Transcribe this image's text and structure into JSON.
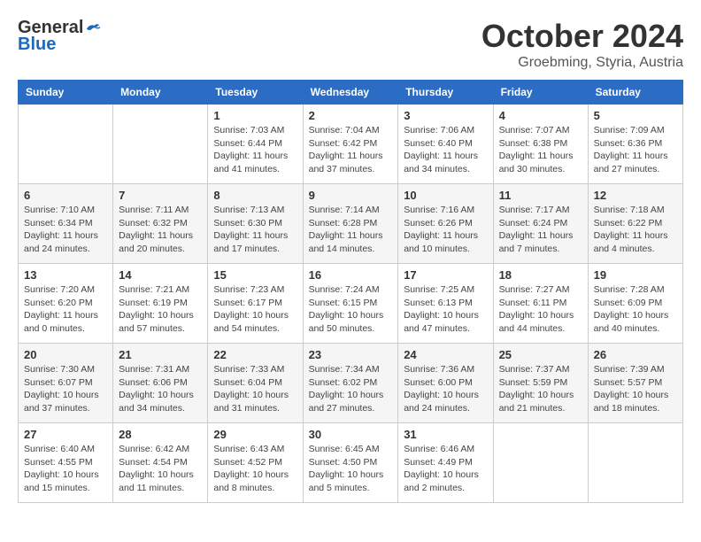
{
  "logo": {
    "general": "General",
    "blue": "Blue"
  },
  "title": "October 2024",
  "location": "Groebming, Styria, Austria",
  "headers": [
    "Sunday",
    "Monday",
    "Tuesday",
    "Wednesday",
    "Thursday",
    "Friday",
    "Saturday"
  ],
  "weeks": [
    [
      {
        "day": "",
        "detail": ""
      },
      {
        "day": "",
        "detail": ""
      },
      {
        "day": "1",
        "detail": "Sunrise: 7:03 AM\nSunset: 6:44 PM\nDaylight: 11 hours and 41 minutes."
      },
      {
        "day": "2",
        "detail": "Sunrise: 7:04 AM\nSunset: 6:42 PM\nDaylight: 11 hours and 37 minutes."
      },
      {
        "day": "3",
        "detail": "Sunrise: 7:06 AM\nSunset: 6:40 PM\nDaylight: 11 hours and 34 minutes."
      },
      {
        "day": "4",
        "detail": "Sunrise: 7:07 AM\nSunset: 6:38 PM\nDaylight: 11 hours and 30 minutes."
      },
      {
        "day": "5",
        "detail": "Sunrise: 7:09 AM\nSunset: 6:36 PM\nDaylight: 11 hours and 27 minutes."
      }
    ],
    [
      {
        "day": "6",
        "detail": "Sunrise: 7:10 AM\nSunset: 6:34 PM\nDaylight: 11 hours and 24 minutes."
      },
      {
        "day": "7",
        "detail": "Sunrise: 7:11 AM\nSunset: 6:32 PM\nDaylight: 11 hours and 20 minutes."
      },
      {
        "day": "8",
        "detail": "Sunrise: 7:13 AM\nSunset: 6:30 PM\nDaylight: 11 hours and 17 minutes."
      },
      {
        "day": "9",
        "detail": "Sunrise: 7:14 AM\nSunset: 6:28 PM\nDaylight: 11 hours and 14 minutes."
      },
      {
        "day": "10",
        "detail": "Sunrise: 7:16 AM\nSunset: 6:26 PM\nDaylight: 11 hours and 10 minutes."
      },
      {
        "day": "11",
        "detail": "Sunrise: 7:17 AM\nSunset: 6:24 PM\nDaylight: 11 hours and 7 minutes."
      },
      {
        "day": "12",
        "detail": "Sunrise: 7:18 AM\nSunset: 6:22 PM\nDaylight: 11 hours and 4 minutes."
      }
    ],
    [
      {
        "day": "13",
        "detail": "Sunrise: 7:20 AM\nSunset: 6:20 PM\nDaylight: 11 hours and 0 minutes."
      },
      {
        "day": "14",
        "detail": "Sunrise: 7:21 AM\nSunset: 6:19 PM\nDaylight: 10 hours and 57 minutes."
      },
      {
        "day": "15",
        "detail": "Sunrise: 7:23 AM\nSunset: 6:17 PM\nDaylight: 10 hours and 54 minutes."
      },
      {
        "day": "16",
        "detail": "Sunrise: 7:24 AM\nSunset: 6:15 PM\nDaylight: 10 hours and 50 minutes."
      },
      {
        "day": "17",
        "detail": "Sunrise: 7:25 AM\nSunset: 6:13 PM\nDaylight: 10 hours and 47 minutes."
      },
      {
        "day": "18",
        "detail": "Sunrise: 7:27 AM\nSunset: 6:11 PM\nDaylight: 10 hours and 44 minutes."
      },
      {
        "day": "19",
        "detail": "Sunrise: 7:28 AM\nSunset: 6:09 PM\nDaylight: 10 hours and 40 minutes."
      }
    ],
    [
      {
        "day": "20",
        "detail": "Sunrise: 7:30 AM\nSunset: 6:07 PM\nDaylight: 10 hours and 37 minutes."
      },
      {
        "day": "21",
        "detail": "Sunrise: 7:31 AM\nSunset: 6:06 PM\nDaylight: 10 hours and 34 minutes."
      },
      {
        "day": "22",
        "detail": "Sunrise: 7:33 AM\nSunset: 6:04 PM\nDaylight: 10 hours and 31 minutes."
      },
      {
        "day": "23",
        "detail": "Sunrise: 7:34 AM\nSunset: 6:02 PM\nDaylight: 10 hours and 27 minutes."
      },
      {
        "day": "24",
        "detail": "Sunrise: 7:36 AM\nSunset: 6:00 PM\nDaylight: 10 hours and 24 minutes."
      },
      {
        "day": "25",
        "detail": "Sunrise: 7:37 AM\nSunset: 5:59 PM\nDaylight: 10 hours and 21 minutes."
      },
      {
        "day": "26",
        "detail": "Sunrise: 7:39 AM\nSunset: 5:57 PM\nDaylight: 10 hours and 18 minutes."
      }
    ],
    [
      {
        "day": "27",
        "detail": "Sunrise: 6:40 AM\nSunset: 4:55 PM\nDaylight: 10 hours and 15 minutes."
      },
      {
        "day": "28",
        "detail": "Sunrise: 6:42 AM\nSunset: 4:54 PM\nDaylight: 10 hours and 11 minutes."
      },
      {
        "day": "29",
        "detail": "Sunrise: 6:43 AM\nSunset: 4:52 PM\nDaylight: 10 hours and 8 minutes."
      },
      {
        "day": "30",
        "detail": "Sunrise: 6:45 AM\nSunset: 4:50 PM\nDaylight: 10 hours and 5 minutes."
      },
      {
        "day": "31",
        "detail": "Sunrise: 6:46 AM\nSunset: 4:49 PM\nDaylight: 10 hours and 2 minutes."
      },
      {
        "day": "",
        "detail": ""
      },
      {
        "day": "",
        "detail": ""
      }
    ]
  ]
}
